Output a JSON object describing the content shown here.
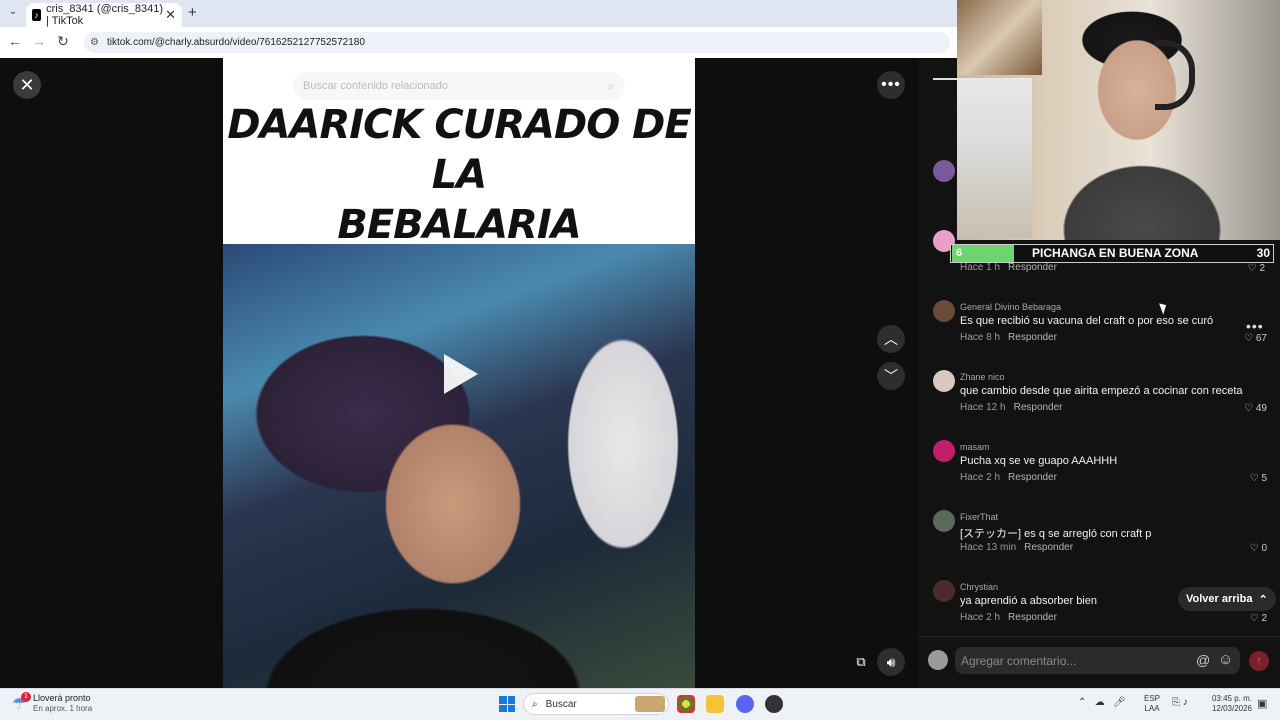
{
  "browser": {
    "tab_title": "cris_8341 (@cris_8341) | TikTok",
    "tab_close": "✕",
    "new_tab": "+",
    "url": "tiktok.com/@charly.absurdo/video/7616252127752572180"
  },
  "video": {
    "search_placeholder": "Buscar contenido relacionado",
    "title_line1": "DAARICK CURADO DE LA",
    "title_line2": "BEBALARIA"
  },
  "comments": [
    {
      "name": "",
      "text": "",
      "time": "",
      "reply": "",
      "likes": ""
    },
    {
      "name": "",
      "text": "",
      "time": "Hace 1 h",
      "reply": "Responder",
      "likes": "2"
    },
    {
      "name": "General Divino Bebaraga",
      "text": "Es que recibió su vacuna del craft o por eso se curó",
      "time": "Hace 8 h",
      "reply": "Responder",
      "likes": "67"
    },
    {
      "name": "Zhane nico",
      "text": "que cambio desde que airita empezó a cocinar con receta",
      "time": "Hace 12 h",
      "reply": "Responder",
      "likes": "49"
    },
    {
      "name": "masam",
      "text": "Pucha xq se ve guapo AAAHHH",
      "time": "Hace 2 h",
      "reply": "Responder",
      "likes": "5"
    },
    {
      "name": "FixerThat",
      "text": "[ステッカー] es q se arregló con craft p",
      "time": "Hace 13 min",
      "reply": "Responder",
      "likes": "0"
    },
    {
      "name": "Chrystian",
      "text": "ya aprendió a absorber bien",
      "time": "Hace 2 h",
      "reply": "Responder",
      "likes": "2"
    }
  ],
  "back_to_top": "Volver arriba",
  "comment_input_placeholder": "Agregar comentario...",
  "overlay": {
    "score_left": "6",
    "score_title": "PICHANGA EN BUENA ZONA",
    "score_right": "30"
  },
  "taskbar": {
    "weather_badge": "1",
    "weather_title": "Lloverá pronto",
    "weather_sub": "En aprox. 1 hora",
    "search_label": "Buscar",
    "lang_top": "ESP",
    "lang_bottom": "LAA",
    "time": "03:45 p. m.",
    "date": "12/03/2026"
  },
  "colors": {
    "accent_red": "#fe2c55",
    "score_green": "#6fd36f",
    "panel_bg": "#121212"
  },
  "icons": [
    "close-icon",
    "more-icon",
    "chevron-up-icon",
    "chevron-down-icon",
    "play-icon",
    "volume-icon",
    "pip-icon",
    "heart-icon",
    "at-icon",
    "emoji-icon",
    "send-icon",
    "windows-start-icon",
    "search-icon"
  ]
}
